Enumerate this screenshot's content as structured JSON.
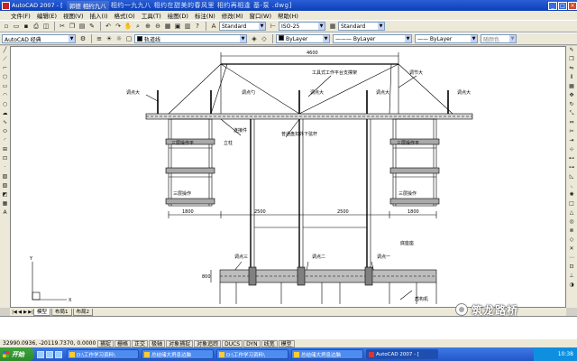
{
  "window": {
    "title": "AutoCAD 2007 - [",
    "music_pill": "郭德 相约九八",
    "ticker": "相约一九九八  相约在甜美的春风里  相约再相逢  基-泵 .dwg]",
    "minimize_icon": "minimize-icon",
    "maximize_icon": "maximize-icon",
    "close_icon": "close-icon"
  },
  "menu": [
    "文件(F)",
    "编辑(E)",
    "视图(V)",
    "插入(I)",
    "格式(O)",
    "工具(T)",
    "绘图(D)",
    "标注(N)",
    "修改(M)",
    "窗口(W)",
    "帮助(H)"
  ],
  "toolbar1": {
    "text_style": "Standard",
    "dim_style": "ISO-25",
    "table_style": "Standard"
  },
  "toolbar2": {
    "workspace": "AutoCAD 经典",
    "layer": "轨道线",
    "color": "ByLayer",
    "linetype": "ByLayer",
    "lineweight": "ByLayer",
    "plotstyle": "随颜色"
  },
  "drawing_labels": {
    "dim_top": "4600",
    "lbl_top_center": "工具式工作平台支撑架",
    "lbl_top_right": "调节大",
    "lbl_left_top": "调点大",
    "lbl_mid_left": "调点勺",
    "lbl_mid_center": "调点大",
    "lbl_right_mid": "调点大",
    "lbl_far_right": "调点大",
    "lbl_brace_left": "连接件",
    "lbl_brace_center": "普通盘扣外下弦杆",
    "lbl_left_support1": "三层操作平",
    "lbl_left_support2": "三层操作",
    "lbl_left_col": "立柱",
    "lbl_right_support1": "三层操作平",
    "lbl_right_support2": "三层操作",
    "dims_mid": [
      "1800",
      "2500",
      "2500",
      "1800"
    ],
    "lbl_col_1": "调点三",
    "lbl_col_2": "调点二",
    "lbl_col_3": "调点一",
    "lbl_ground_right": "底座座",
    "lbl_base_right": "盾构机",
    "dim_base": "800",
    "ucs_x": "X",
    "ucs_y": "Y"
  },
  "layout_tabs": {
    "model": "模型",
    "layout1": "布局1",
    "layout2": "布局2"
  },
  "status": {
    "coords": "32990.0936, -20119.7370, 0.0000",
    "toggles": [
      "捕捉",
      "栅格",
      "正交",
      "极轴",
      "对象捕捉",
      "对象追踪",
      "DUCS",
      "DYN",
      "线宽",
      "模型"
    ]
  },
  "taskbar": {
    "start": "开始",
    "tasks": [
      "D:\\工作学习资料\\",
      "总结储大坍息边脑",
      "D:\\工作学习资料\\",
      "总结储大坍息边脑",
      "AutoCAD 2007 - ["
    ],
    "time": "10:38"
  },
  "watermark": "筑龙路桥",
  "colors": {
    "drawing_bg": "#ffffff",
    "steel_fill": "#a9a9a9",
    "accent_blue": "#2357c9"
  }
}
